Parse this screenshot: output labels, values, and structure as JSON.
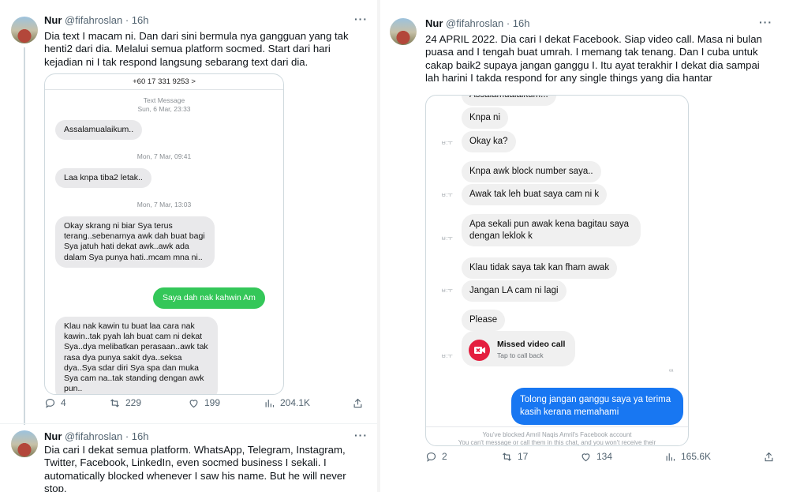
{
  "left_tweet": {
    "author_name": "Nur",
    "author_handle": "@fifahroslan",
    "time": "· 16h",
    "more": "···",
    "text": "Dia text I macam ni. Dan dari sini bermula nya gangguan yang tak henti2 dari dia. Melalui semua platform socmed. Start dari hari kejadian ni I tak respond langsung sebarang text dari dia.",
    "sms": {
      "phone": "+60 17 331 9253 >",
      "meta1_type": "Text Message",
      "meta1_time": "Sun, 6 Mar, 23:33",
      "msg1": "Assalamualaikum..",
      "meta2": "Mon, 7 Mar, 09:41",
      "msg2": "Laa knpa tiba2 letak..",
      "meta3": "Mon, 7 Mar, 13:03",
      "msg3": "Okay skrang ni biar Sya terus terang..sebenarnya awk dah buat bagi Sya jatuh hati dekat awk..awk ada dalam Sya punya hati..mcam mna ni..",
      "msg4_sent": "Saya dah nak kahwin Am",
      "msg5": "Klau nak kawin tu buat laa cara nak kawin..tak pyah lah buat cam ni dekat Sya..dya melibatkan perasaan..awk tak rasa dya punya sakit dya..seksa dya..Sya sdar diri Sya spa dan muka Sya cam na..tak standing dengan awk pun.."
    },
    "actions": {
      "replies": "4",
      "reposts": "229",
      "likes": "199",
      "views": "204.1K"
    }
  },
  "reply_tweet": {
    "author_name": "Nur",
    "author_handle": "@fifahroslan",
    "time": "· 16h",
    "more": "···",
    "text": "Dia cari I dekat semua platform. WhatsApp, Telegram, Instagram, Twitter, Facebook, LinkedIn, even socmed business I sekali. I automatically blocked whenever I saw his name. But he will never stop."
  },
  "right_tweet": {
    "author_name": "Nur",
    "author_handle": "@fifahroslan",
    "time": "· 16h",
    "more": "···",
    "text": "24 APRIL 2022. Dia cari I dekat Facebook. Siap video call. Masa ni bulan puasa and I tengah buat umrah. I memang tak tenang. Dan I cuba untuk cakap baik2 supaya jangan ganggu I. Itu ayat terakhir I dekat dia sampai lah harini I takda respond for any single things yang dia hantar",
    "fb": {
      "cut_top": "Assalamualaikum...",
      "msg1": "Knpa ni",
      "msg2": "Okay ka?",
      "msg3": "Knpa awk block number saya..",
      "msg4": "Awak tak leh buat saya cam ni k",
      "msg5": "Apa sekali pun awak kena bagitau saya dengan leklok k",
      "msg6": "Klau tidak saya tak kan fham awak",
      "msg7": "Jangan LA cam ni lagi",
      "msg8": "Please",
      "missed_title": "Missed video call",
      "missed_sub": "Tap to call back",
      "sent": "Tolong jangan ganggu saya ya terima kasih kerana memahami",
      "side_time": "ㅂ:ㅜ",
      "footer1": "You've blocked Amril Naqis Amril's Facebook account",
      "footer2": "You can't message or call them in this chat, and you won't receive their"
    },
    "actions": {
      "replies": "2",
      "reposts": "17",
      "likes": "134",
      "views": "165.6K"
    }
  },
  "icons": [
    "reply-icon",
    "repost-icon",
    "like-icon",
    "views-icon",
    "share-icon",
    "more-icon",
    "video-camera-icon"
  ],
  "colors": {
    "sms_green": "#34c759",
    "fb_blue": "#1877f2",
    "missed_red": "#e41e3f",
    "muted": "#536471"
  }
}
